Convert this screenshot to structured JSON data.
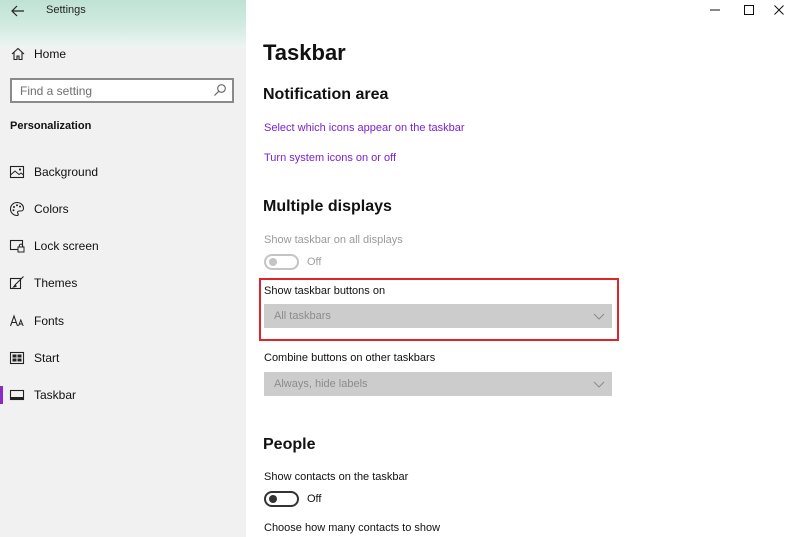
{
  "window": {
    "title": "Settings"
  },
  "sidebar": {
    "home_label": "Home",
    "search_placeholder": "Find a setting",
    "section_label": "Personalization",
    "items": [
      {
        "label": "Background",
        "icon": "image-icon"
      },
      {
        "label": "Colors",
        "icon": "palette-icon"
      },
      {
        "label": "Lock screen",
        "icon": "lock-screen-icon"
      },
      {
        "label": "Themes",
        "icon": "brush-icon"
      },
      {
        "label": "Fonts",
        "icon": "fonts-icon"
      },
      {
        "label": "Start",
        "icon": "start-icon"
      },
      {
        "label": "Taskbar",
        "icon": "taskbar-icon",
        "active": true
      }
    ],
    "accent_color": "#8a2bc8"
  },
  "main": {
    "title": "Taskbar",
    "notification_area": {
      "heading": "Notification area",
      "links": [
        "Select which icons appear on the taskbar",
        "Turn system icons on or off"
      ],
      "link_color": "#7a1fd4"
    },
    "multiple_displays": {
      "heading": "Multiple displays",
      "show_all_label": "Show taskbar on all displays",
      "show_all_state": "Off",
      "buttons_on_label": "Show taskbar buttons on",
      "buttons_on_value": "All taskbars",
      "combine_label": "Combine buttons on other taskbars",
      "combine_value": "Always, hide labels"
    },
    "people": {
      "heading": "People",
      "show_contacts_label": "Show contacts on the taskbar",
      "show_contacts_state": "Off",
      "choose_contacts_label": "Choose how many contacts to show"
    },
    "highlight_color": "#e0242c"
  }
}
